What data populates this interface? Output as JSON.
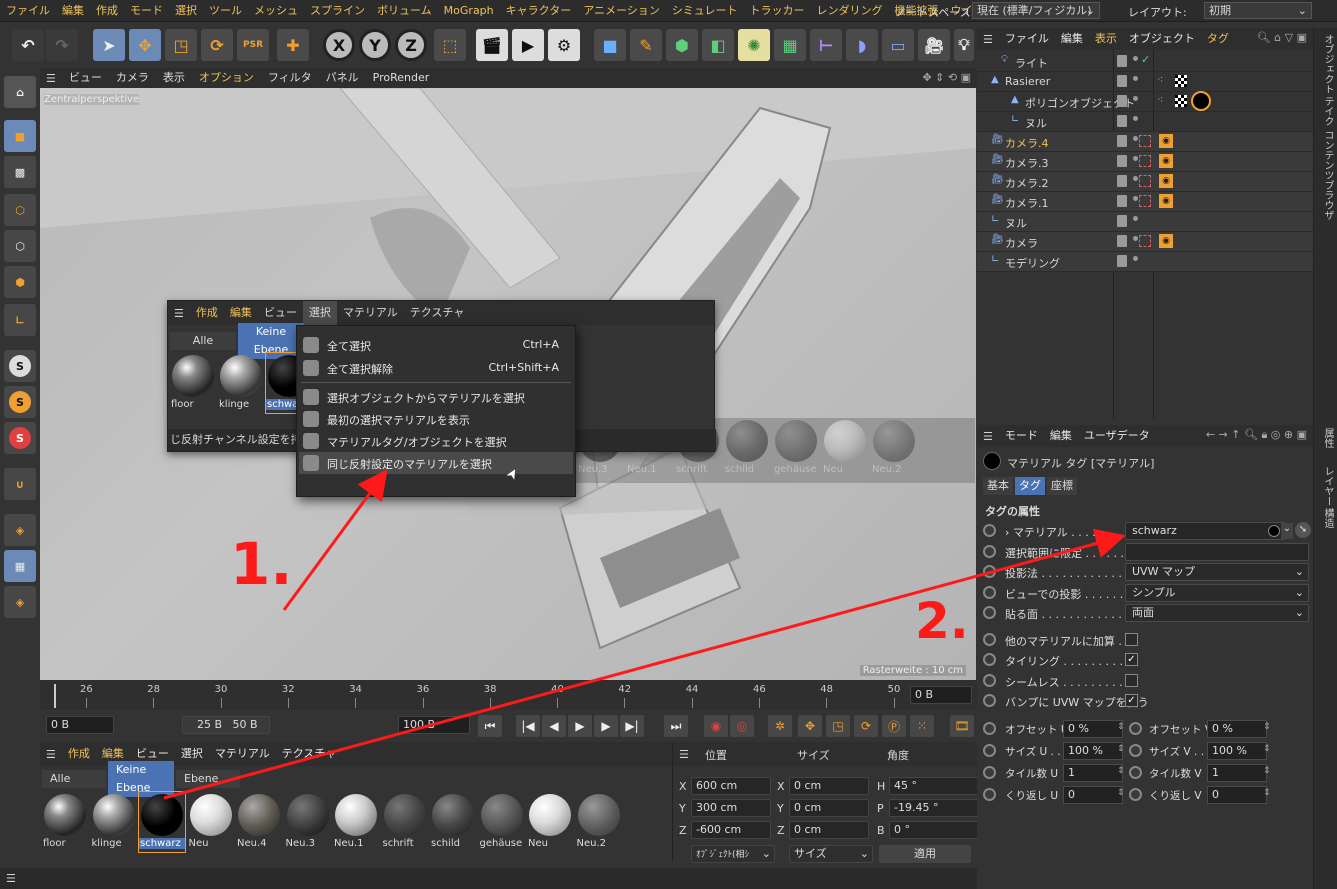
{
  "menubar": {
    "items": [
      "ファイル",
      "編集",
      "作成",
      "モード",
      "選択",
      "ツール",
      "メッシュ",
      "スプライン",
      "ボリューム",
      "MoGraph",
      "キャラクター",
      "アニメーション",
      "シミュレート",
      "トラッカー",
      "レンダリング",
      "機能拡張",
      "ウインドウ"
    ],
    "node_space_label": "ノードスペース:",
    "node_space_value": "現在 (標準/フィジカル)",
    "layout_label": "レイアウト:",
    "layout_value": "初期"
  },
  "toolbar": {
    "psr": "PSR",
    "x": "X",
    "y": "Y",
    "z": "Z"
  },
  "viewport": {
    "menu": [
      "ビュー",
      "カメラ",
      "表示",
      "オプション",
      "フィルタ",
      "パネル",
      "ProRender"
    ],
    "label": "Zentralperspektive",
    "grid_label": "Rasterweite : 10 cm"
  },
  "timeline": {
    "ticks": [
      "26",
      "28",
      "30",
      "32",
      "34",
      "36",
      "38",
      "40",
      "42",
      "44",
      "46",
      "48",
      "50"
    ],
    "frame_field": "0 B"
  },
  "transport": {
    "start": "0 B",
    "range_a": "25 B",
    "range_b": "50 B",
    "end": "100 B"
  },
  "material_panel": {
    "menu": [
      "作成",
      "編集",
      "ビュー",
      "選択",
      "マテリアル",
      "テクスチャ"
    ],
    "tabs": [
      "Alle",
      "Keine Ebene",
      "Ebene"
    ],
    "materials": [
      "floor",
      "klinge",
      "schwarz",
      "Neu",
      "Neu.4",
      "Neu.3",
      "Neu.1",
      "schrift",
      "schild",
      "gehäuse",
      "Neu",
      "Neu.2"
    ]
  },
  "floating_material": {
    "menu": [
      "作成",
      "編集",
      "ビュー",
      "選択",
      "マテリアル",
      "テクスチャ"
    ],
    "tabs": [
      "Alle",
      "Keine Ebene"
    ],
    "materials": [
      "floor",
      "klinge",
      "schwa"
    ],
    "status": "じ反射チャンネル設定を持つマ",
    "bg_materials": [
      "Neu.3",
      "Neu.1",
      "schrift",
      "schild",
      "gehäuse",
      "Neu",
      "Neu.2"
    ]
  },
  "dropdown": {
    "items": [
      {
        "label": "全て選択",
        "shortcut": "Ctrl+A"
      },
      {
        "label": "全て選択解除",
        "shortcut": "Ctrl+Shift+A"
      },
      {
        "label": "選択オブジェクトからマテリアルを選択",
        "shortcut": ""
      },
      {
        "label": "最初の選択マテリアルを表示",
        "shortcut": ""
      },
      {
        "label": "マテリアルタグ/オブジェクトを選択",
        "shortcut": ""
      },
      {
        "label": "同じ反射設定のマテリアルを選択",
        "shortcut": ""
      }
    ]
  },
  "coords": {
    "headers": [
      "位置",
      "サイズ",
      "角度"
    ],
    "rows": [
      {
        "axis": "X",
        "pos": "600 cm",
        "saxis": "X",
        "size": "0 cm",
        "aaxis": "H",
        "angle": "45 °"
      },
      {
        "axis": "Y",
        "pos": "300 cm",
        "saxis": "Y",
        "size": "0 cm",
        "aaxis": "P",
        "angle": "-19.45 °"
      },
      {
        "axis": "Z",
        "pos": "-600 cm",
        "saxis": "Z",
        "size": "0 cm",
        "aaxis": "B",
        "angle": "0 °"
      }
    ],
    "mode": "ｵﾌﾞｼﾞｪｸﾄ(相ｼ",
    "size_mode": "サイズ",
    "apply": "適用"
  },
  "object_manager": {
    "menu": [
      "ファイル",
      "編集",
      "表示",
      "オブジェクト",
      "タグ"
    ],
    "objects": [
      {
        "name": "ライト",
        "indent": 1
      },
      {
        "name": "Rasierer",
        "indent": 0
      },
      {
        "name": "ポリゴンオブジェクト",
        "indent": 2
      },
      {
        "name": "ヌル",
        "indent": 2
      },
      {
        "name": "カメラ.4",
        "indent": 0
      },
      {
        "name": "カメラ.3",
        "indent": 0
      },
      {
        "name": "カメラ.2",
        "indent": 0
      },
      {
        "name": "カメラ.1",
        "indent": 0
      },
      {
        "name": "ヌル",
        "indent": 0
      },
      {
        "name": "カメラ",
        "indent": 0
      },
      {
        "name": "モデリング",
        "indent": 0
      }
    ]
  },
  "side_tabs": [
    "オブジェクト",
    "テイク",
    "コンテンツブラウザ",
    "属性",
    "レイヤー",
    "構造"
  ],
  "attributes": {
    "menu": [
      "モード",
      "編集",
      "ユーザデータ"
    ],
    "title": "マテリアル タグ [マテリアル]",
    "tabs": [
      "基本",
      "タグ",
      "座標"
    ],
    "section": "タグの属性",
    "rows": [
      {
        "label": "› マテリアル . . . . . . . . . . .",
        "value": "schwarz",
        "kind": "field"
      },
      {
        "label": "選択範囲に限定 . . . . . . . .",
        "value": "",
        "kind": "field"
      },
      {
        "label": "投影法 . . . . . . . . . . . . .",
        "value": "UVW マップ",
        "kind": "select"
      },
      {
        "label": "ビューでの投影 . . . . . . . .",
        "value": "シンプル",
        "kind": "select"
      },
      {
        "label": "貼る面 . . . . . . . . . . . . .",
        "value": "両面",
        "kind": "select"
      },
      {
        "label": "他のマテリアルに加算 .",
        "value": "",
        "kind": "check"
      },
      {
        "label": "タイリング . . . . . . . . . .",
        "value": "✓",
        "kind": "check"
      },
      {
        "label": "シームレス . . . . . . . . . .",
        "value": "",
        "kind": "check"
      },
      {
        "label": "バンプに UVW マップを使う",
        "value": "✓",
        "kind": "check"
      }
    ],
    "pairs": [
      {
        "l1": "オフセット U",
        "v1": "0 %",
        "l2": "オフセット V",
        "v2": "0 %"
      },
      {
        "l1": "サイズ U . .",
        "v1": "100 %",
        "l2": "サイズ V . .",
        "v2": "100 %"
      },
      {
        "l1": "タイル数 U",
        "v1": "1",
        "l2": "タイル数 V",
        "v2": "1"
      },
      {
        "l1": "くり返し U",
        "v1": "0",
        "l2": "くり返し V",
        "v2": "0"
      }
    ]
  },
  "annotations": {
    "one": "1.",
    "two": "2."
  },
  "colors": {
    "accent": "#4b73b3",
    "highlight": "#f0c25a",
    "annotation": "#ff1a1a"
  }
}
